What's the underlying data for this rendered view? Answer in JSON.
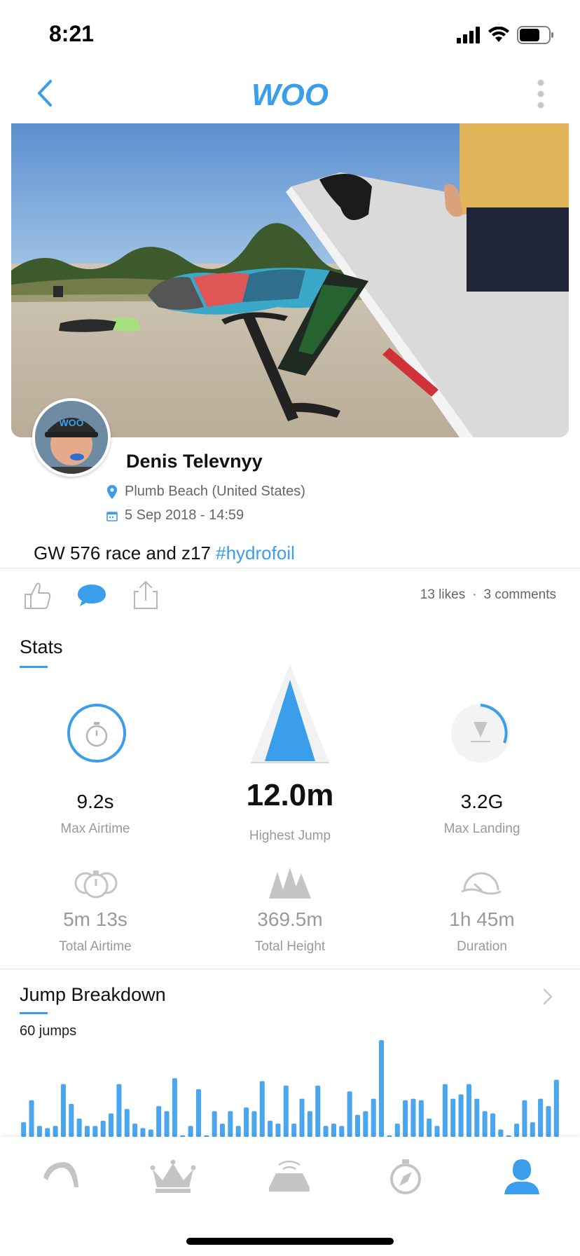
{
  "status_bar": {
    "time": "8:21"
  },
  "nav": {
    "logo_text": "WOO"
  },
  "post": {
    "user_name": "Denis Televnyy",
    "location": "Plumb Beach (United States)",
    "date": "5 Sep 2018 - 14:59",
    "caption": "GW 576 race and z17 ",
    "hashtag": "#hydrofoil",
    "likes": "13 likes",
    "separator": "·",
    "comments": "3 comments"
  },
  "stats": {
    "title": "Stats",
    "items": [
      {
        "value": "9.2s",
        "label": "Max Airtime"
      },
      {
        "value": "12.0m",
        "label": "Highest Jump"
      },
      {
        "value": "3.2G",
        "label": "Max Landing"
      },
      {
        "value": "5m 13s",
        "label": "Total Airtime"
      },
      {
        "value": "369.5m",
        "label": "Total Height"
      },
      {
        "value": "1h 45m",
        "label": "Duration"
      }
    ]
  },
  "jumps": {
    "title": "Jump Breakdown",
    "count": "60 jumps",
    "bar_values": [
      20,
      50,
      15,
      12,
      15,
      72,
      45,
      25,
      15,
      15,
      22,
      32,
      72,
      38,
      18,
      12,
      10,
      42,
      35,
      80,
      2,
      15,
      65,
      2,
      35,
      18,
      35,
      15,
      40,
      35,
      76,
      22,
      18,
      70,
      18,
      52,
      35,
      70,
      15,
      18,
      15,
      62,
      30,
      35,
      52,
      132,
      2,
      18,
      50,
      52,
      50,
      25,
      15,
      72,
      52,
      58,
      72,
      52,
      35,
      32,
      10,
      2,
      18,
      50,
      20,
      52,
      42,
      78
    ],
    "bar_color": "#4aa6ee"
  },
  "tabs": [
    {
      "name": "kite-tab-icon"
    },
    {
      "name": "leaderboard-crown-icon"
    },
    {
      "name": "device-tab-icon"
    },
    {
      "name": "explore-compass-icon"
    },
    {
      "name": "profile-tab-icon"
    }
  ],
  "colors": {
    "accent": "#3a9eea",
    "muted": "#9a9a9a"
  }
}
